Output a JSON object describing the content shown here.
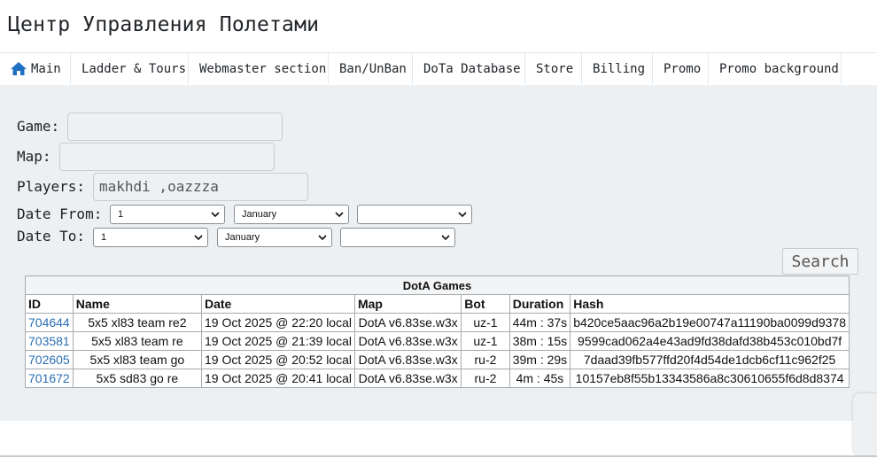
{
  "site": {
    "title": "Центр Управления Полетами"
  },
  "nav": {
    "items": [
      {
        "label": "Main",
        "icon": "home-icon"
      },
      {
        "label": "Ladder & Tours"
      },
      {
        "label": "Webmaster section"
      },
      {
        "label": "Ban/UnBan"
      },
      {
        "label": "DoTa Database"
      },
      {
        "label": "Store"
      },
      {
        "label": "Billing"
      },
      {
        "label": "Promo"
      },
      {
        "label": "Promo background"
      }
    ]
  },
  "form": {
    "game_label": "Game:",
    "game_value": "",
    "map_label": "Map:",
    "map_value": "",
    "players_label": "Players:",
    "players_value": "makhdi ,oazzza",
    "date_from_label": "Date From:",
    "date_to_label": "Date To:",
    "date_from": {
      "day": "1",
      "month": "January",
      "year": ""
    },
    "date_to": {
      "day": "1",
      "month": "January",
      "year": ""
    },
    "search_label": "Search"
  },
  "table": {
    "caption": "DotA Games",
    "headers": [
      "ID",
      "Name",
      "Date",
      "Map",
      "Bot",
      "Duration",
      "Hash"
    ],
    "rows": [
      {
        "id": "704644",
        "name": "5x5 xl83 team re2",
        "date": "19 Oct 2025 @ 22:20 local",
        "map": "DotA v6.83se.w3x",
        "bot": "uz-1",
        "duration": "44m : 37s",
        "hash": "b420ce5aac96a2b19e00747a11190ba0099d9378"
      },
      {
        "id": "703581",
        "name": "5x5 xl83 team re",
        "date": "19 Oct 2025 @ 21:39 local",
        "map": "DotA v6.83se.w3x",
        "bot": "uz-1",
        "duration": "38m : 15s",
        "hash": "9599cad062a4e43ad9fd38dafd38b453c010bd7f"
      },
      {
        "id": "702605",
        "name": "5x5 xl83 team go",
        "date": "19 Oct 2025 @ 20:52 local",
        "map": "DotA v6.83se.w3x",
        "bot": "ru-2",
        "duration": "39m : 29s",
        "hash": "7daad39fb577ffd20f4d54de1dcb6cf11c962f25"
      },
      {
        "id": "701672",
        "name": "5x5 sd83 go re",
        "date": "19 Oct 2025 @ 20:41 local",
        "map": "DotA v6.83se.w3x",
        "bot": "ru-2",
        "duration": "4m : 45s",
        "hash": "10157eb8f55b13343586a8c30610655f6d8d8374"
      }
    ]
  },
  "colors": {
    "link": "#2a6fb5",
    "panel_bg": "#ecf0f3",
    "home_icon": "#1f6fc2"
  }
}
